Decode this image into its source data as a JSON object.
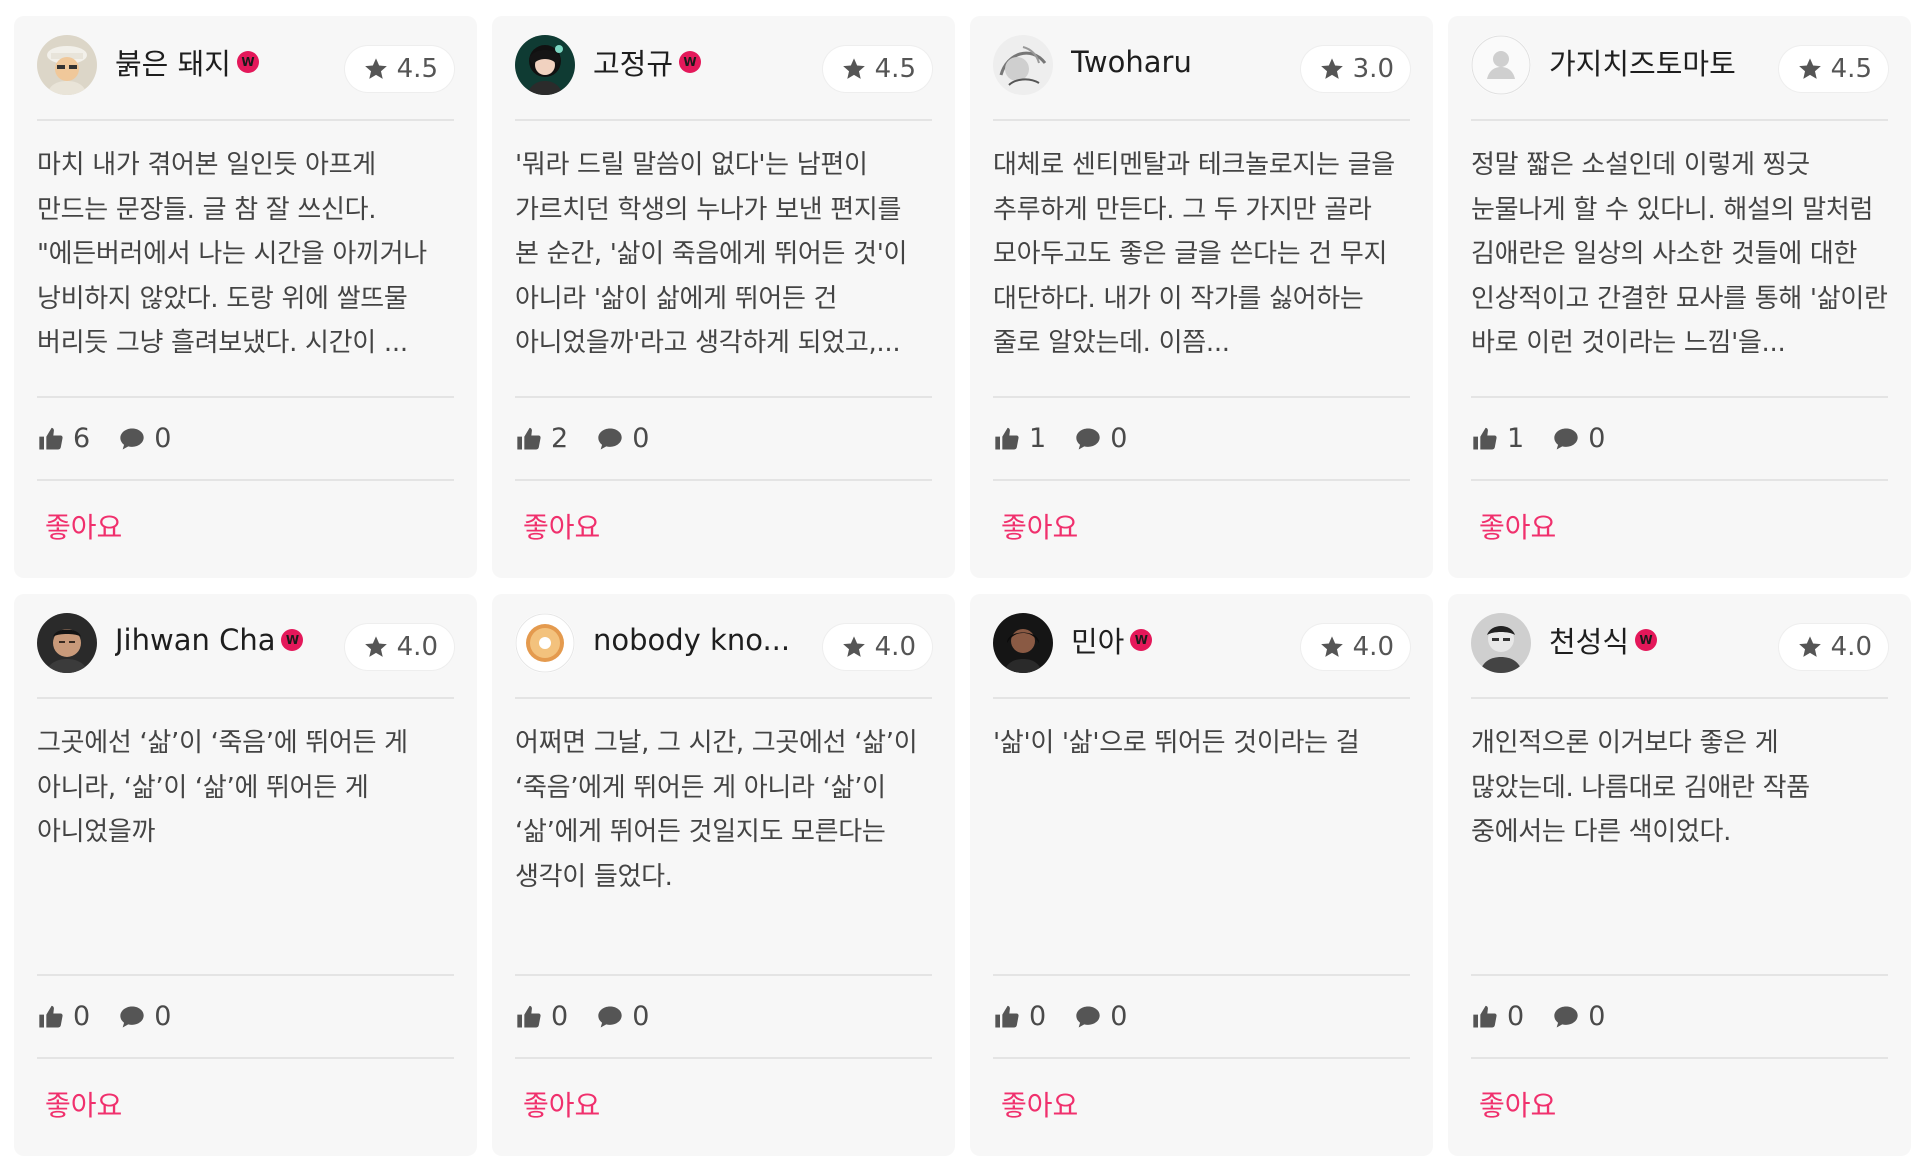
{
  "comments": [
    {
      "username": "붉은 돼지",
      "has_badge": true,
      "avatar": "avatar-cartoon-man",
      "rating": "4.5",
      "text": "마치 내가 겪어본 일인듯 아프게 만드는 문장들. 글 참 잘 쓰신다. \"에든버러에서 나는 시간을 아끼거나 낭비하지 않았다. 도랑 위에 쌀뜨물 버리듯 그냥 흘려보냈다. 시간이 ...",
      "likes": "6",
      "replies": "0",
      "like_label": "좋아요"
    },
    {
      "username": "고정규",
      "has_badge": true,
      "avatar": "avatar-anime-girl",
      "rating": "4.5",
      "text": "'뭐라 드릴 말씀이 없다'는 남편이 가르치던 학생의 누나가 보낸 편지를 본 순간, '삶이 죽음에게 뛰어든 것'이 아니라 '삶이 삶에게 뛰어든 건 아니었을까'라고 생각하게 되었고,...",
      "likes": "2",
      "replies": "0",
      "like_label": "좋아요"
    },
    {
      "username": "Twoharu",
      "has_badge": false,
      "avatar": "avatar-sketch",
      "rating": "3.0",
      "text": "대체로 센티멘탈과 테크놀로지는 글을 추루하게 만든다. 그 두 가지만 골라 모아두고도 좋은 글을 쓴다는 건 무지 대단하다. 내가 이 작가를 싫어하는 줄로 알았는데. 이쯤...",
      "likes": "1",
      "replies": "0",
      "like_label": "좋아요"
    },
    {
      "username": "가지치즈토마토",
      "has_badge": false,
      "avatar": "avatar-default",
      "rating": "4.5",
      "text": "정말 짧은 소설인데 이렇게 찡긋 눈물나게 할 수 있다니. 해설의 말처럼 김애란은 일상의 사소한 것들에 대한 인상적이고 간결한 묘사를 통해 '삶이란 바로 이런 것이라는 느낌'을...",
      "likes": "1",
      "replies": "0",
      "like_label": "좋아요"
    },
    {
      "username": "Jihwan Cha",
      "has_badge": true,
      "avatar": "avatar-photo-man",
      "rating": "4.0",
      "text": "그곳에선 ‘삶’이 ‘죽음’에 뛰어든 게 아니라, ‘삶’이 ‘삶’에 뛰어든 게 아니었을까",
      "likes": "0",
      "replies": "0",
      "like_label": "좋아요"
    },
    {
      "username": "nobody kno...",
      "has_badge": false,
      "avatar": "avatar-donut",
      "rating": "4.0",
      "text": "어쩌면 그날, 그 시간, 그곳에선 ‘삶’이 ‘죽음’에게 뛰어든 게 아니라 ‘삶’이 ‘삶’에게 뛰어든 것일지도 모른다는 생각이 들었다.",
      "likes": "0",
      "replies": "0",
      "like_label": "좋아요"
    },
    {
      "username": "민아",
      "has_badge": true,
      "avatar": "avatar-dark-photo",
      "rating": "4.0",
      "text": "'삶'이 '삶'으로 뛰어든 것이라는 걸",
      "likes": "0",
      "replies": "0",
      "like_label": "좋아요"
    },
    {
      "username": "천성식",
      "has_badge": true,
      "avatar": "avatar-bw-photo",
      "rating": "4.0",
      "text": "개인적으론 이거보다 좋은 게 많았는데. 나름대로 김애란 작품 중에서는 다른 색이었다.",
      "likes": "0",
      "replies": "0",
      "like_label": "좋아요"
    }
  ],
  "colors": {
    "card_bg": "#f7f7f7",
    "accent_pink": "#f0306d",
    "badge_red": "#e4185a",
    "divider": "#e4e4e4"
  },
  "icons": {
    "rating": "star-icon",
    "likes": "thumbs-up-icon",
    "replies": "speech-bubble-icon",
    "verified": "watcha-badge-icon"
  }
}
